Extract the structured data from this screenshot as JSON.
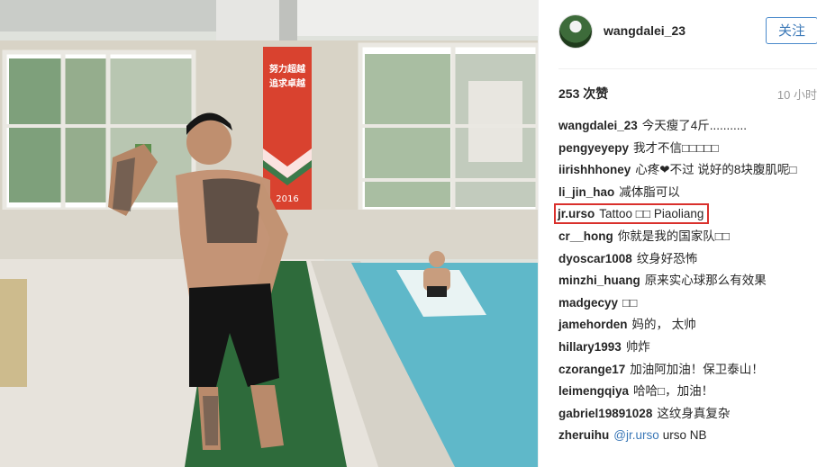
{
  "post": {
    "username": "wangdalei_23",
    "follow_label": "关注",
    "likes": "253 次赞",
    "time": "10 小时"
  },
  "banner": {
    "line1": "努力超越",
    "line2": "追求卓越",
    "year": "2016"
  },
  "comments": [
    {
      "user": "wangdalei_23",
      "text": "今天瘦了4斤..........."
    },
    {
      "user": "pengyeyepy",
      "text": "我才不信□□□□□"
    },
    {
      "user": "iirishhhoney",
      "text": "心疼❤不过 说好的8块腹肌呢□"
    },
    {
      "user": "li_jin_hao",
      "text": "减体脂可以"
    },
    {
      "user": "jr.urso",
      "text": "Tattoo □□ Piaoliang",
      "highlighted": true
    },
    {
      "user": "cr__hong",
      "text": "你就是我的国家队□□"
    },
    {
      "user": "dyoscar1008",
      "text": "纹身好恐怖"
    },
    {
      "user": "minzhi_huang",
      "text": "原来实心球那么有效果"
    },
    {
      "user": "madgecyy",
      "text": "□□"
    },
    {
      "user": "jamehorden",
      "text": "妈的， 太帅"
    },
    {
      "user": "hillary1993",
      "text": "帅炸"
    },
    {
      "user": "czorange17",
      "text": "加油阿加油！保卫泰山！"
    },
    {
      "user": "leimengqiya",
      "text": "哈哈□，加油！"
    },
    {
      "user": "gabriel19891028",
      "text": "这纹身真复杂"
    },
    {
      "user": "zheruihu",
      "mention": "@jr.urso",
      "text": "urso NB"
    }
  ],
  "colors": {
    "accent": "#3b78b7",
    "highlight": "#d9302c",
    "banner": "#d9422f",
    "pool": "#5fb8c9"
  }
}
